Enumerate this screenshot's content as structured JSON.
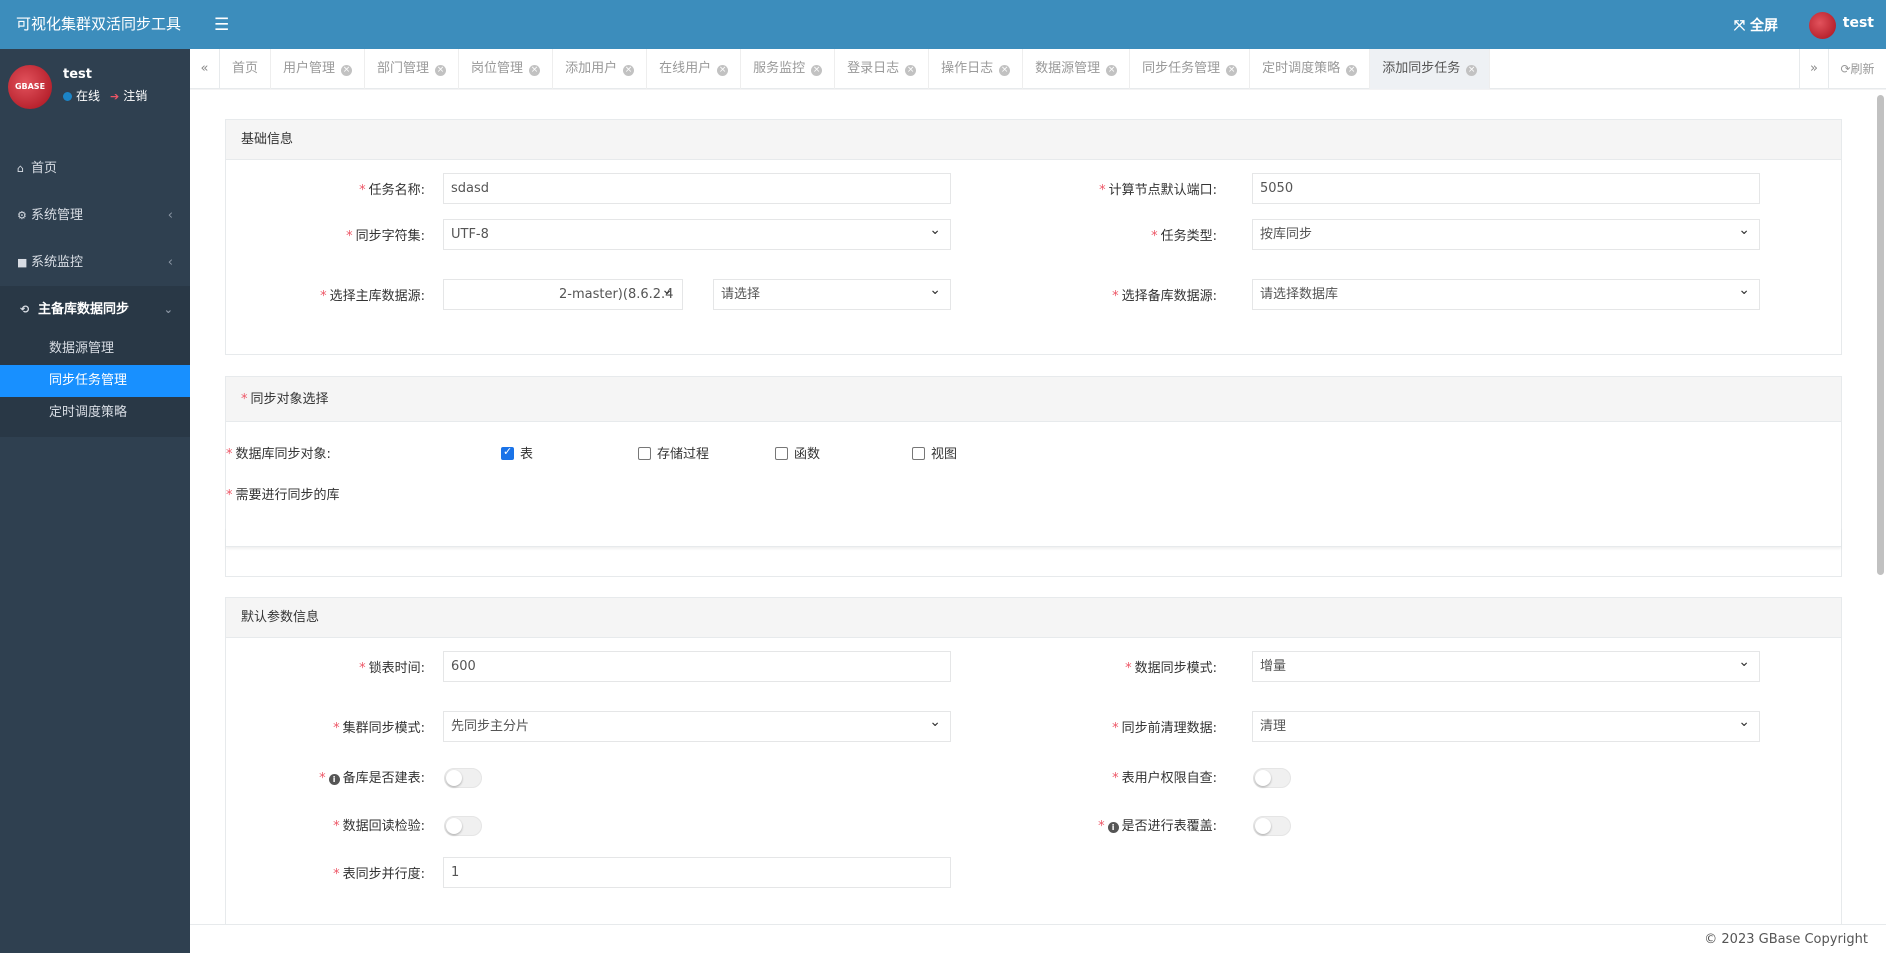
{
  "app": {
    "title": "可视化集群双活同步工具"
  },
  "user": {
    "name": "test",
    "status": "在线",
    "logout": "注销",
    "avatar_text": "GBASE"
  },
  "topbar": {
    "fullscreen": "全屏",
    "user": "test"
  },
  "sidebar": {
    "items": [
      {
        "label": "首页",
        "icon": "home-icon"
      },
      {
        "label": "系统管理",
        "icon": "gear-icon"
      },
      {
        "label": "系统监控",
        "icon": "video-icon"
      },
      {
        "label": "主备库数据同步",
        "icon": "sync-icon"
      }
    ],
    "subitems": [
      {
        "label": "数据源管理"
      },
      {
        "label": "同步任务管理"
      },
      {
        "label": "定时调度策略"
      }
    ]
  },
  "tabs": [
    "首页",
    "用户管理",
    "部门管理",
    "岗位管理",
    "添加用户",
    "在线用户",
    "服务监控",
    "登录日志",
    "操作日志",
    "数据源管理",
    "同步任务管理",
    "定时调度策略",
    "添加同步任务"
  ],
  "tab_refresh": "刷新",
  "basic": {
    "title": "基础信息",
    "task_name_label": "任务名称:",
    "task_name_value": "sdasd",
    "port_label": "计算节点默认端口:",
    "port_value": "5050",
    "charset_label": "同步字符集:",
    "charset_value": "UTF-8",
    "task_type_label": "任务类型:",
    "task_type_value": "按库同步",
    "master_label": "选择主库数据源:",
    "master_value": "2-master)(8.6.2.4",
    "master_db_value": "请选择",
    "backup_label": "选择备库数据源:",
    "backup_value": "请选择数据库"
  },
  "sync_obj": {
    "title": "同步对象选择",
    "objects_label": "数据库同步对象:",
    "options": [
      {
        "label": "表",
        "checked": true
      },
      {
        "label": "存储过程",
        "checked": false
      },
      {
        "label": "函数",
        "checked": false
      },
      {
        "label": "视图",
        "checked": false
      }
    ],
    "db_label": "需要进行同步的库"
  },
  "defaults": {
    "title": "默认参数信息",
    "lock_label": "锁表时间:",
    "lock_value": "600",
    "mode_label": "数据同步模式:",
    "mode_value": "增量",
    "cluster_label": "集群同步模式:",
    "cluster_value": "先同步主分片",
    "clean_label": "同步前清理数据:",
    "clean_value": "清理",
    "create_table_label": "备库是否建表:",
    "perm_label": "表用户权限自查:",
    "readback_label": "数据回读检验:",
    "overwrite_label": "是否进行表覆盖:",
    "parallel_label": "表同步并行度:",
    "parallel_value": "1"
  },
  "footer": "© 2023 GBase Copyright"
}
